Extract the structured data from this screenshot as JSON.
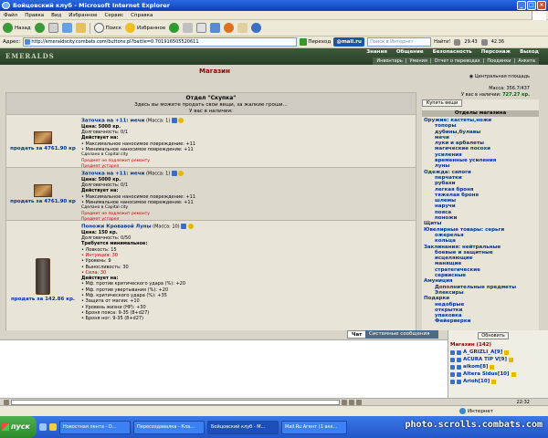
{
  "window": {
    "title": "Бойцовский клуб - Microsoft Internet Explorer"
  },
  "menu": [
    "Файл",
    "Правка",
    "Вид",
    "Избранное",
    "Сервис",
    "Справка"
  ],
  "toolbar": {
    "back": "Назад",
    "search": "Поиск",
    "favorites": "Избранное"
  },
  "address": {
    "label": "Адрес:",
    "url": "http://emeraldscity.combats.com/buttons.pl?battle=0.701916505520611",
    "go": "Переход",
    "mailru": "@mail.ru",
    "search_placeholder": "Поиск в Интернет",
    "find": "Найти!",
    "weather1": "29.43",
    "weather2": "42.36"
  },
  "game": {
    "logo": "EMERALDS",
    "nav1": [
      "Знания",
      "Общение",
      "Безопасность",
      "Персонаж",
      "Выход"
    ],
    "nav2": [
      "Инвентарь",
      "Умения",
      "Отчет о переводах",
      "Поединки",
      "Анкета"
    ]
  },
  "shop": {
    "title": "Магазин",
    "location_link": "Центральная площадь",
    "mass": "Масса: 356.7/437",
    "money_label": "У вас в наличии:",
    "money": "727.27 кр.",
    "dept_title": "Отдел \"Скупка\"",
    "dept_desc": "Здесь вы можете продать свои вещи, за жалкие гроши...",
    "dept_have": "У вас в наличии:",
    "buy_btn": "Купить вещи",
    "depts_title": "Отделы магазина"
  },
  "items": [
    {
      "sell": "продать за 4761.90 кр",
      "name": "Заточка на +11: мечи",
      "mass": "(Масса: 1)",
      "price": "Цена: 5000 кр.",
      "durability": "Долговечность: 0/1",
      "acts": "Действует на:",
      "lines": [
        "• Максимальное наносимое повреждение: +11",
        "• Минимальное наносимое повреждение: +11"
      ],
      "made": "Сделано в Capital city",
      "note1": "Предмет не подлежит ремонту",
      "note2": "Предмет устарел"
    },
    {
      "sell": "продать за 4761.90 кр",
      "name": "Заточка на +11: мечи",
      "mass": "(Масса: 1)",
      "price": "Цена: 5000 кр.",
      "durability": "Долговечность: 0/1",
      "acts": "Действует на:",
      "lines": [
        "• Максимальное наносимое повреждение: +11",
        "• Минимальное наносимое повреждение: +11"
      ],
      "made": "Сделано в Capital city",
      "note1": "Предмет не подлежит ремонту",
      "note2": "Предмет устарел"
    }
  ],
  "item3": {
    "sell": "продать за 142.86 кр.",
    "name": "Поножи Кровавой Луны",
    "mass": "(Масса: 10)",
    "price": "Цена: 150 кр.",
    "durability": "Долговечность: 0/50",
    "req": "Требуется минимальное:",
    "req_lines": [
      {
        "t": "• Ловкость: 15",
        "red": false
      },
      {
        "t": "• Интуиция: 30",
        "red": true
      },
      {
        "t": "• Уровень: 9",
        "red": false
      },
      {
        "t": "• Выносливость: 30",
        "red": false
      },
      {
        "t": "• Сила: 30",
        "red": true
      }
    ],
    "acts": "Действует на:",
    "act_lines": [
      "• Мф. против критического удара (%): +20",
      "• Мф. против увертывания (%): +20",
      "• Мф. критического удара (%): +35",
      "• Защита от магии: +10",
      "• Уровень жизни (HP): +30",
      "• Броня пояса: 9-35 (8+d27)",
      "• Броня ног: 9-35 (8+d27)"
    ]
  },
  "departments": [
    {
      "t": "Оружие: кастеты,ножи",
      "cat": true
    },
    {
      "t": "топоры",
      "cat": false
    },
    {
      "t": "дубины,булавы",
      "cat": false
    },
    {
      "t": "мечи",
      "cat": false
    },
    {
      "t": "луки и арбалеты",
      "cat": false
    },
    {
      "t": "магические посохи",
      "cat": false
    },
    {
      "t": "усиления",
      "cat": false
    },
    {
      "t": "временные усиления",
      "cat": false
    },
    {
      "t": "луны",
      "cat": false
    },
    {
      "t": "Одежда: сапоги",
      "cat": true
    },
    {
      "t": "перчатки",
      "cat": false
    },
    {
      "t": "рубахи",
      "cat": false
    },
    {
      "t": "легкая броня",
      "cat": false
    },
    {
      "t": "тяжелая броня",
      "cat": false
    },
    {
      "t": "шлемы",
      "cat": false
    },
    {
      "t": "наручи",
      "cat": false
    },
    {
      "t": "пояса",
      "cat": false
    },
    {
      "t": "поножи",
      "cat": false
    },
    {
      "t": "Щиты",
      "cat": true
    },
    {
      "t": "Ювелирные товары: серьги",
      "cat": true
    },
    {
      "t": "ожерелья",
      "cat": false
    },
    {
      "t": "кольца",
      "cat": false
    },
    {
      "t": "Заклинания: нейтральные",
      "cat": true
    },
    {
      "t": "боевые и защитные",
      "cat": false
    },
    {
      "t": "исцеляющие",
      "cat": false
    },
    {
      "t": "манящие",
      "cat": false
    },
    {
      "t": "стратегические",
      "cat": false
    },
    {
      "t": "сервисные",
      "cat": false
    },
    {
      "t": "Амуниция",
      "cat": true
    },
    {
      "t": "Дополнительные предметы",
      "cat": false
    },
    {
      "t": "Элексиры",
      "cat": false
    },
    {
      "t": "Подарки",
      "cat": true
    },
    {
      "t": "недобрые",
      "cat": false
    },
    {
      "t": "открытки",
      "cat": false
    },
    {
      "t": "упаковка",
      "cat": false
    },
    {
      "t": "Фейерверки",
      "cat": false
    }
  ],
  "chat": {
    "tab_chat": "Чат",
    "tab_sys": "Системные сообщения"
  },
  "room": {
    "refresh": "Обновить",
    "title": "Магазин (142)",
    "users": [
      "A_GRIZLI_A[9]",
      "ACURA TIP V[9]",
      "aikom[8]",
      "Altera Sidus[10]",
      "Arioh[10]"
    ]
  },
  "inputbar": {
    "clock": "22:32"
  },
  "status": {
    "zone": "Интернет"
  },
  "taskbar": {
    "start": "пуск",
    "tasks": [
      "Новостная лента - D...",
      "Пересоздавалка - Кла...",
      "Бойцовский клуб - M...",
      "Mail.Ru Агент (1 акк..."
    ],
    "watermark": "photo.scrolls.combats.com"
  }
}
